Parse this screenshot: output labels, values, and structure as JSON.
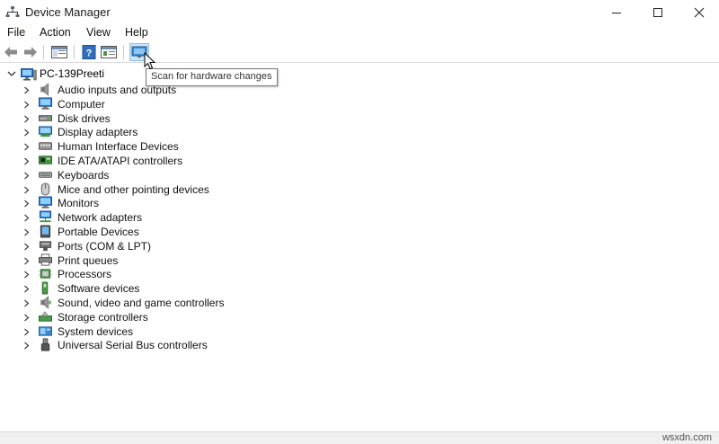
{
  "window": {
    "title": "Device Manager"
  },
  "menu": [
    "File",
    "Action",
    "View",
    "Help"
  ],
  "tooltip": "Scan for hardware changes",
  "tree": {
    "root": "PC-139Preeti",
    "categories": [
      {
        "label": "Audio inputs and outputs",
        "icon": "speaker-icon"
      },
      {
        "label": "Computer",
        "icon": "computer-icon"
      },
      {
        "label": "Disk drives",
        "icon": "disk-drive-icon"
      },
      {
        "label": "Display adapters",
        "icon": "display-adapter-icon"
      },
      {
        "label": "Human Interface Devices",
        "icon": "hid-icon"
      },
      {
        "label": "IDE ATA/ATAPI controllers",
        "icon": "ide-controller-icon"
      },
      {
        "label": "Keyboards",
        "icon": "keyboard-icon"
      },
      {
        "label": "Mice and other pointing devices",
        "icon": "mouse-icon"
      },
      {
        "label": "Monitors",
        "icon": "monitor-icon"
      },
      {
        "label": "Network adapters",
        "icon": "network-adapter-icon"
      },
      {
        "label": "Portable Devices",
        "icon": "portable-device-icon"
      },
      {
        "label": "Ports (COM & LPT)",
        "icon": "port-icon"
      },
      {
        "label": "Print queues",
        "icon": "printer-icon"
      },
      {
        "label": "Processors",
        "icon": "processor-icon"
      },
      {
        "label": "Software devices",
        "icon": "software-device-icon"
      },
      {
        "label": "Sound, video and game controllers",
        "icon": "sound-controller-icon"
      },
      {
        "label": "Storage controllers",
        "icon": "storage-controller-icon"
      },
      {
        "label": "System devices",
        "icon": "system-device-icon"
      },
      {
        "label": "Universal Serial Bus controllers",
        "icon": "usb-icon"
      }
    ]
  },
  "watermark": "wsxdn.com",
  "colors": {
    "accent": "#2f7fd0",
    "selected_bg": "#cce4f7"
  }
}
